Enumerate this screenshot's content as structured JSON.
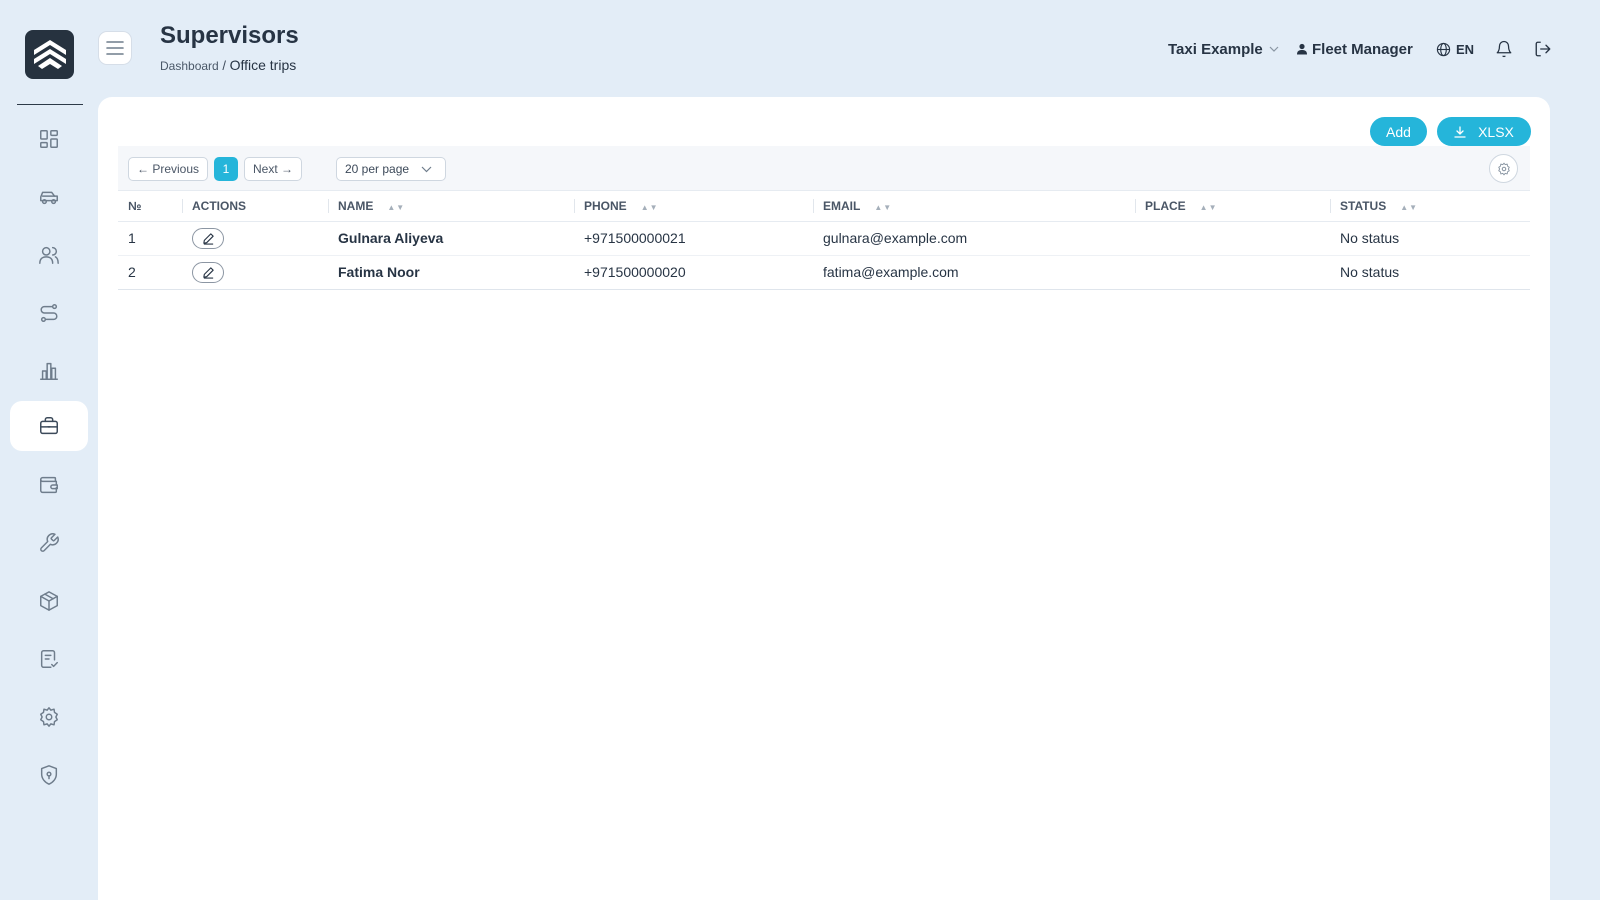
{
  "header": {
    "title": "Supervisors",
    "breadcrumb": {
      "root": "Dashboard",
      "separator": "/",
      "current": "Office trips"
    },
    "company": "Taxi Example",
    "user": "Fleet Manager",
    "language": "EN"
  },
  "sidebar": {
    "items": [
      {
        "icon": "dashboard-icon"
      },
      {
        "icon": "car-icon"
      },
      {
        "icon": "users-icon"
      },
      {
        "icon": "route-icon"
      },
      {
        "icon": "chart-icon"
      },
      {
        "icon": "briefcase-icon",
        "active": true
      },
      {
        "icon": "wallet-icon"
      },
      {
        "icon": "wrench-icon"
      },
      {
        "icon": "package-icon"
      },
      {
        "icon": "checklist-icon"
      },
      {
        "icon": "gear-icon"
      },
      {
        "icon": "shield-icon"
      }
    ]
  },
  "toolbar": {
    "add_label": "Add",
    "xlsx_label": "XLSX",
    "prev_label": "← Previous",
    "page": "1",
    "next_label": "Next →",
    "per_page": "20 per page"
  },
  "table": {
    "columns": [
      "№",
      "ACTIONS",
      "NAME",
      "PHONE",
      "EMAIL",
      "PLACE",
      "STATUS"
    ],
    "rows": [
      {
        "num": "1",
        "name": "Gulnara Aliyeva",
        "phone": "+971500000021",
        "email": "gulnara@example.com",
        "place": "",
        "status": "No status"
      },
      {
        "num": "2",
        "name": "Fatima Noor",
        "phone": "+971500000020",
        "email": "fatima@example.com",
        "place": "",
        "status": "No status"
      }
    ]
  },
  "colors": {
    "accent": "#25b5da",
    "background": "#e3edf7",
    "logo_bg": "#26323f"
  }
}
